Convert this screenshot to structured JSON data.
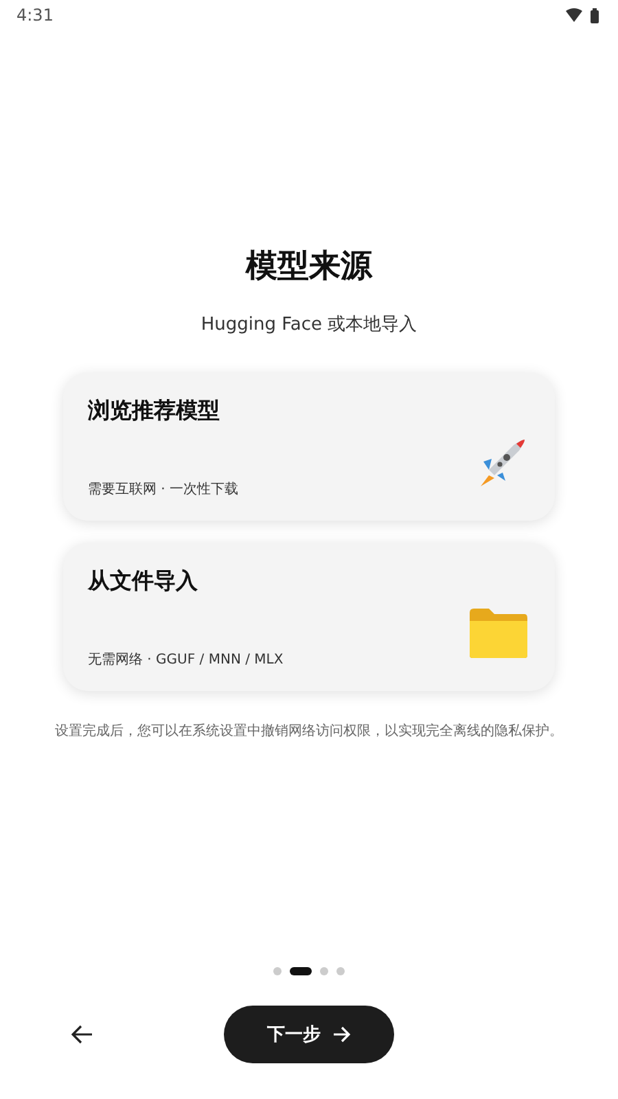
{
  "status_bar": {
    "time": "4:31"
  },
  "title": "模型来源",
  "subtitle": "Hugging Face 或本地导入",
  "options": [
    {
      "kind": "rocket",
      "title": "浏览推荐模型",
      "detail": "需要互联网 · 一次性下载"
    },
    {
      "kind": "folder",
      "title": "从文件导入",
      "detail": "无需网络 · GGUF / MNN / MLX"
    }
  ],
  "note": "设置完成后，您可以在系统设置中撤销网络访问权限，以实现完全离线的隐私保护。",
  "pages": [
    {
      "selected": false
    },
    {
      "selected": true
    },
    {
      "selected": false
    },
    {
      "selected": false
    }
  ],
  "next_button": "下一步"
}
